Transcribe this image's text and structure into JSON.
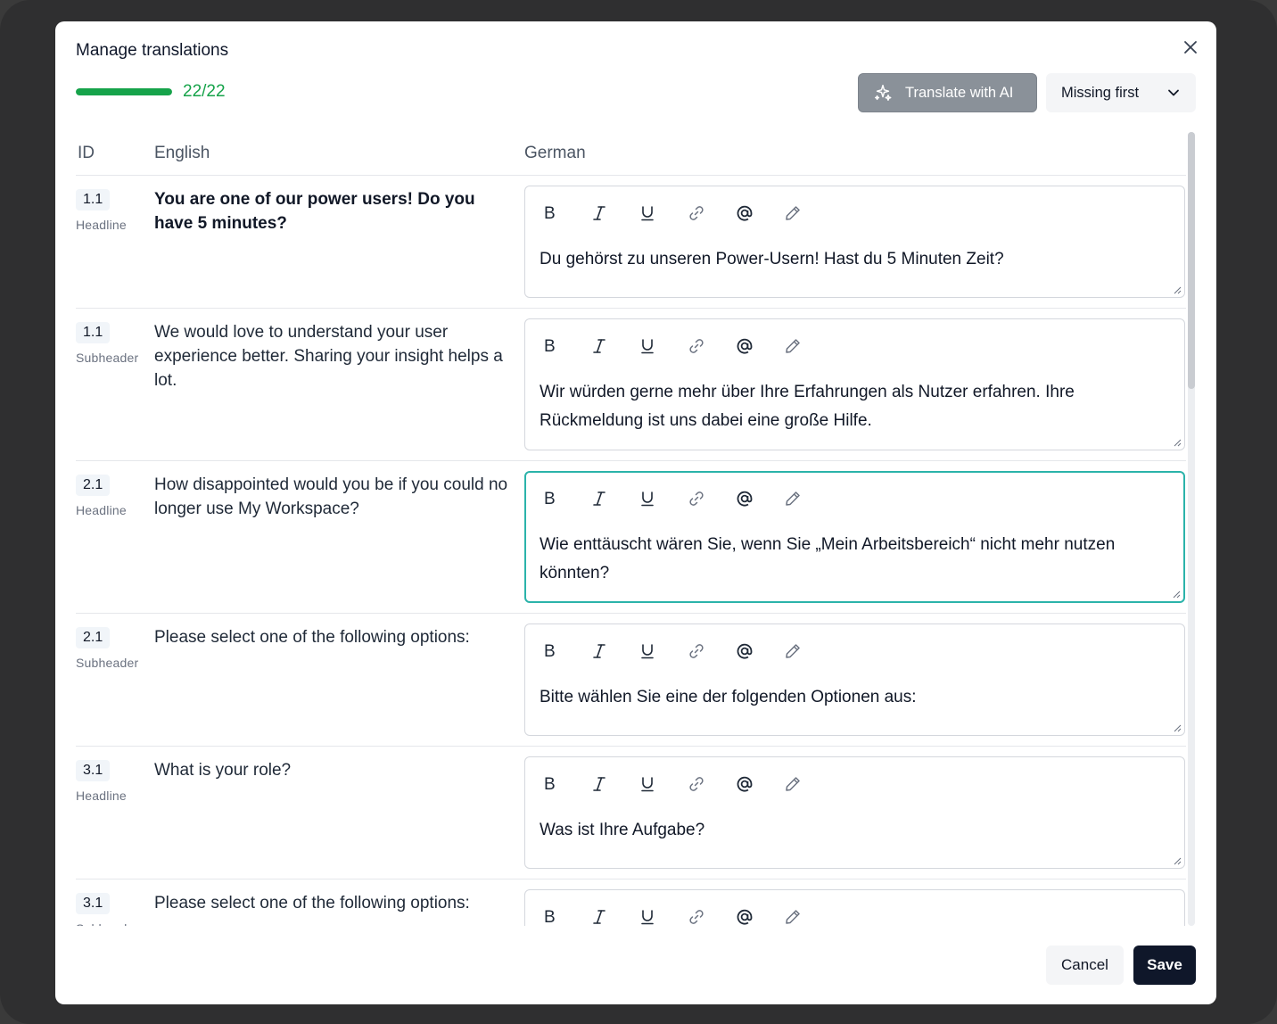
{
  "modal": {
    "title": "Manage translations",
    "progress": {
      "label": "22/22",
      "fraction": 1.0,
      "color": "#16a34a"
    },
    "ai_button_label": "Translate with AI",
    "sort": {
      "selected": "Missing first"
    },
    "columns": {
      "id": "ID",
      "source": "English",
      "target": "German"
    },
    "toolbar_icons": [
      "bold-icon",
      "italic-icon",
      "underline-icon",
      "link-icon",
      "mention-icon",
      "pencil-icon"
    ],
    "rows": [
      {
        "id": "1.1",
        "type": "Headline",
        "english": "You are one of our power users! Do you have 5 minutes?",
        "german": "Du gehörst zu unseren Power-Usern! Hast du 5 Minuten Zeit?"
      },
      {
        "id": "1.1",
        "type": "Subheader",
        "english": "We would love to understand your user experience better. Sharing your insight helps a lot.",
        "german": "Wir würden gerne mehr über Ihre Erfahrungen als Nutzer erfahren. Ihre Rückmeldung ist uns dabei eine große Hilfe."
      },
      {
        "id": "2.1",
        "type": "Headline",
        "english": "How disappointed would you be if you could no longer use My Workspace?",
        "german": "Wie enttäuscht wären Sie, wenn Sie „Mein Arbeitsbereich“ nicht mehr nutzen könnten?"
      },
      {
        "id": "2.1",
        "type": "Subheader",
        "english": "Please select one of the following options:",
        "german": "Bitte wählen Sie eine der folgenden Optionen aus:"
      },
      {
        "id": "3.1",
        "type": "Headline",
        "english": "What is your role?",
        "german": "Was ist Ihre Aufgabe?"
      },
      {
        "id": "3.1",
        "type": "Subheader",
        "english": "Please select one of the following options:",
        "german": ""
      }
    ],
    "footer": {
      "cancel": "Cancel",
      "save": "Save"
    }
  }
}
